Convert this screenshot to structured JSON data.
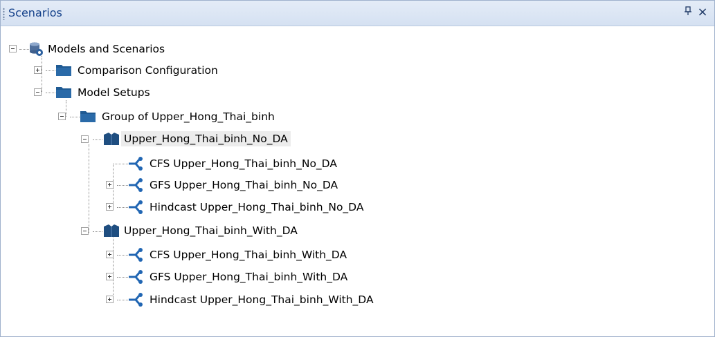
{
  "panel": {
    "title": "Scenarios",
    "pin_glyph": "ᵖ",
    "close_glyph": "×",
    "icons": {
      "pin": "pin-icon",
      "close": "close-icon"
    }
  },
  "tree": {
    "root": "Models and Scenarios",
    "comparison": "Comparison Configuration",
    "model_setups": "Model Setups",
    "group": "Group of Upper_Hong_Thai_binh",
    "setup_no_da": "Upper_Hong_Thai_binh_No_DA",
    "no_da_children": [
      "CFS Upper_Hong_Thai_binh_No_DA",
      "GFS Upper_Hong_Thai_binh_No_DA",
      "Hindcast Upper_Hong_Thai_binh_No_DA"
    ],
    "setup_with_da": "Upper_Hong_Thai_binh_With_DA",
    "with_da_children": [
      "CFS Upper_Hong_Thai_binh_With_DA",
      "GFS Upper_Hong_Thai_binh_With_DA",
      "Hindcast Upper_Hong_Thai_binh_With_DA"
    ]
  },
  "colors": {
    "title_text": "#15428b",
    "folder": "#1f5a93",
    "scenario": "#2166b3",
    "selection": "#ececec"
  }
}
